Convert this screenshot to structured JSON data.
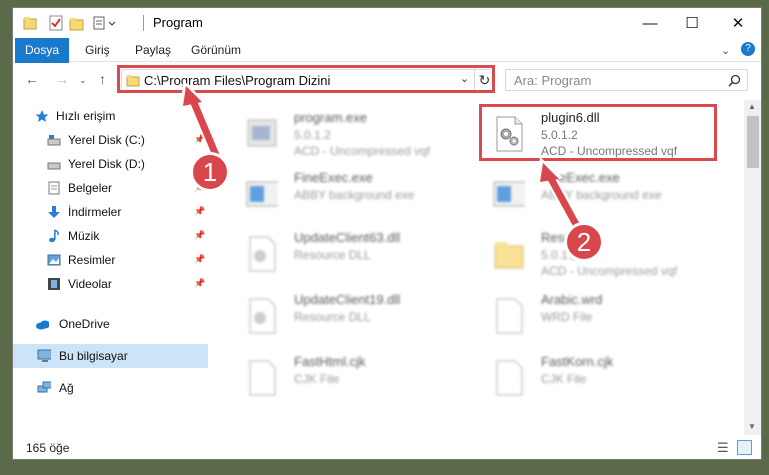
{
  "window": {
    "title": "Program"
  },
  "ribbon": {
    "tabs": [
      "Dosya",
      "Giriş",
      "Paylaş",
      "Görünüm"
    ]
  },
  "address": {
    "path": "C:\\Program Files\\Program Dizini"
  },
  "search": {
    "placeholder": "Ara: Program"
  },
  "sidebar": {
    "items": [
      {
        "label": "Hızlı erişim",
        "pinned": false
      },
      {
        "label": "Yerel Disk (C:)",
        "pinned": true
      },
      {
        "label": "Yerel Disk (D:)",
        "pinned": true
      },
      {
        "label": "Belgeler",
        "pinned": true
      },
      {
        "label": "İndirmeler",
        "pinned": true
      },
      {
        "label": "Müzik",
        "pinned": true
      },
      {
        "label": "Resimler",
        "pinned": true
      },
      {
        "label": "Videolar",
        "pinned": true
      },
      {
        "label": "OneDrive",
        "pinned": false
      },
      {
        "label": "Bu bilgisayar",
        "pinned": false
      },
      {
        "label": "Ağ",
        "pinned": false
      }
    ]
  },
  "files": [
    {
      "name": "program.exe",
      "line1": "5.0.1.2",
      "line2": "ACD - Uncompressed vqf"
    },
    {
      "name": "plugin6.dll",
      "line1": "5.0.1.2",
      "line2": "ACD - Uncompressed vqf"
    },
    {
      "name": "FineExec.exe",
      "line1": "ABBY background exe",
      "line2": ""
    },
    {
      "name": "FineExec.exe",
      "line1": "ABBY background exe",
      "line2": ""
    },
    {
      "name": "UpdateClient63.dll",
      "line1": "Resource DLL",
      "line2": ""
    },
    {
      "name": "Resource",
      "line1": "5.0.1.2",
      "line2": "ACD - Uncompressed vqf"
    },
    {
      "name": "UpdateClient19.dll",
      "line1": "Resource DLL",
      "line2": ""
    },
    {
      "name": "Arabic.wrd",
      "line1": "WRD File",
      "line2": ""
    },
    {
      "name": "FastHtml.cjk",
      "line1": "CJK File",
      "line2": ""
    },
    {
      "name": "FastKorn.cjk",
      "line1": "CJK File",
      "line2": ""
    }
  ],
  "status": {
    "item_count": "165 öğe"
  },
  "annotations": {
    "step1": "1",
    "step2": "2"
  },
  "colors": {
    "accent": "#1979ca",
    "highlight": "#d94a4f",
    "selected": "#cce4f7"
  }
}
